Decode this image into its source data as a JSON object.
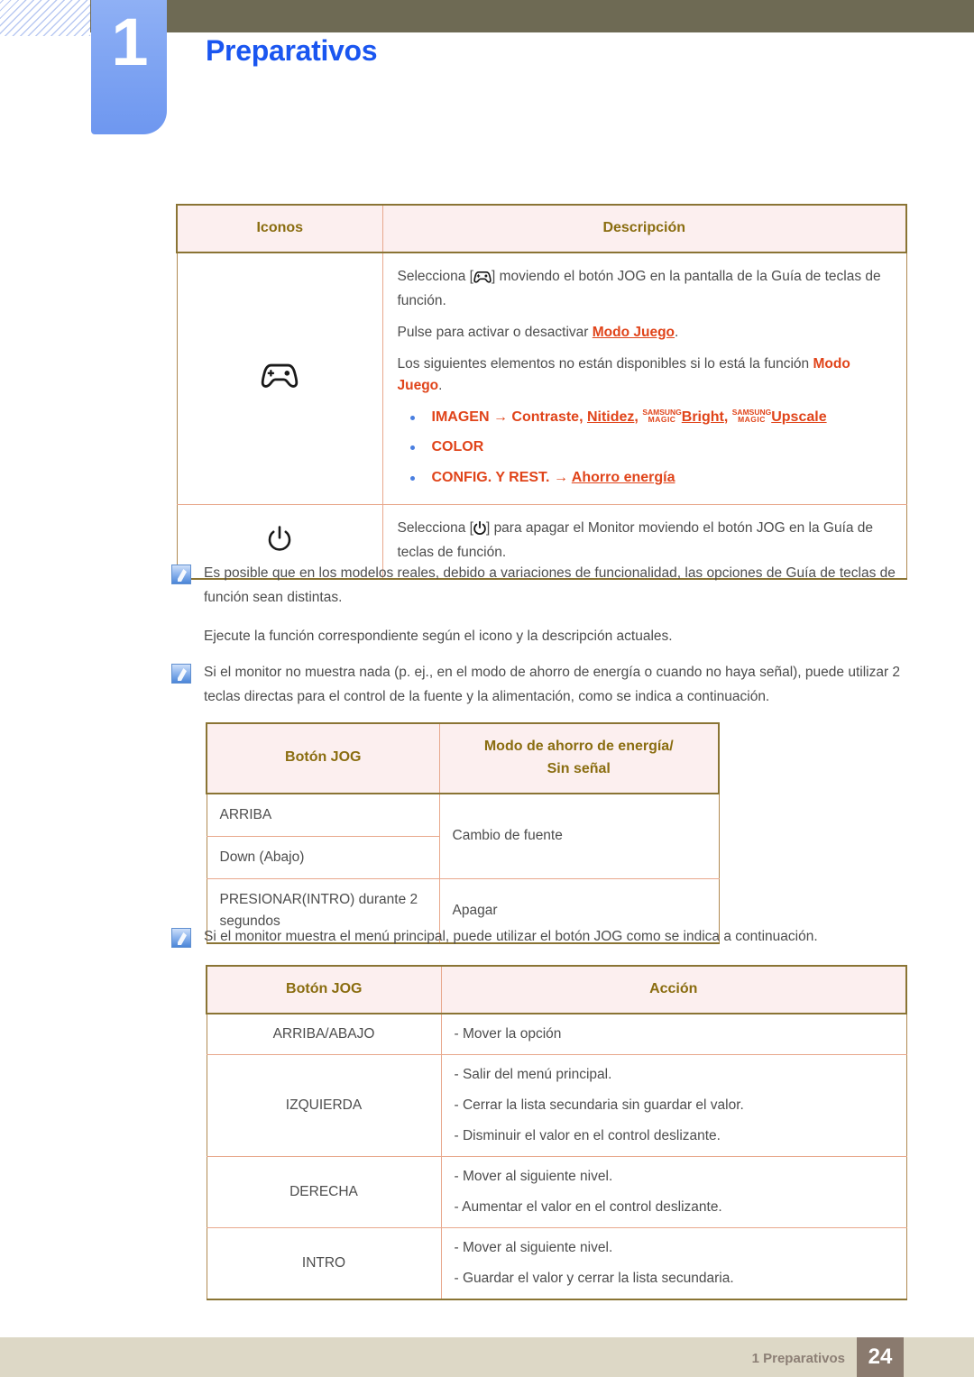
{
  "header": {
    "chapter_number": "1",
    "chapter_title": "Preparativos"
  },
  "table_icons": {
    "headers": [
      "Iconos",
      "Descripción"
    ],
    "rows": [
      {
        "icon": "gamepad-icon",
        "lines": [
          {
            "pre": "Selecciona [",
            "icon": "gamepad-icon",
            "post": "] moviendo el botón JOG en la pantalla de la Guía de teclas de función."
          },
          {
            "pre": "Pulse para activar o desactivar ",
            "link": "Modo Juego",
            "post": "."
          },
          {
            "pre": "Los siguientes elementos no están disponibles si lo está la función ",
            "bold": "Modo Juego",
            "post": "."
          }
        ],
        "bullets": [
          {
            "segments": [
              {
                "text": "IMAGEN",
                "style": "plain"
              },
              {
                "text": " → ",
                "style": "plain"
              },
              {
                "text": "Contraste",
                "style": "plain"
              },
              {
                "text": ", ",
                "style": "plain"
              },
              {
                "text": "Nitidez",
                "style": "underline"
              },
              {
                "text": ", ",
                "style": "plain"
              },
              {
                "text": "SAMSUNG MAGIC",
                "style": "magic"
              },
              {
                "text": "Bright",
                "style": "underline"
              },
              {
                "text": ", ",
                "style": "plain"
              },
              {
                "text": "SAMSUNG MAGIC",
                "style": "magic"
              },
              {
                "text": "Upscale",
                "style": "underline"
              }
            ]
          },
          {
            "segments": [
              {
                "text": "COLOR",
                "style": "plain"
              }
            ]
          },
          {
            "segments": [
              {
                "text": "CONFIG. Y REST.",
                "style": "plain"
              },
              {
                "text": " → ",
                "style": "plain"
              },
              {
                "text": "Ahorro energía",
                "style": "underline"
              }
            ]
          }
        ]
      },
      {
        "icon": "power-icon",
        "lines": [
          {
            "pre": "Selecciona [",
            "icon": "power-icon",
            "post": "] para apagar el Monitor moviendo el botón JOG en la Guía de teclas de función."
          }
        ]
      }
    ],
    "magic_top": "SAMSUNG",
    "magic_bottom": "MAGIC"
  },
  "note_one": {
    "icon": "note-icon",
    "paragraphs": [
      "Es posible que en los modelos reales, debido a variaciones de funcionalidad, las opciones de Guía de teclas de función sean distintas.",
      "Ejecute la función correspondiente según el icono y la descripción actuales."
    ]
  },
  "note_two": {
    "icon": "note-icon",
    "paragraphs": [
      "Si el monitor no muestra nada (p. ej., en el modo de ahorro de energía o cuando no haya señal), puede utilizar 2 teclas directas para el control de la fuente y la alimentación, como se indica a continuación."
    ]
  },
  "note_three": {
    "icon": "note-icon",
    "paragraphs": [
      "Si el monitor muestra el menú principal, puede utilizar el botón JOG como se indica a continuación."
    ]
  },
  "table_jog_power": {
    "headers": [
      "Botón JOG",
      "Modo de ahorro de energía/\nSin señal"
    ],
    "header_line1": "Modo de ahorro de energía/",
    "header_line2": "Sin señal",
    "rows": [
      {
        "button": "ARRIBA",
        "action": "Cambio de fuente"
      },
      {
        "button": "Down (Abajo)",
        "action": ""
      },
      {
        "button": "PRESIONAR(INTRO) durante 2 segundos",
        "action": "Apagar"
      }
    ]
  },
  "table_jog_action": {
    "headers": [
      "Botón JOG",
      "Acción"
    ],
    "rows": [
      {
        "button": "ARRIBA/ABAJO",
        "actions": [
          "- Mover la opción"
        ]
      },
      {
        "button": "IZQUIERDA",
        "actions": [
          "- Salir del menú principal.",
          "- Cerrar la lista secundaria sin guardar el valor.",
          "- Disminuir el valor en el control deslizante."
        ]
      },
      {
        "button": "DERECHA",
        "actions": [
          "- Mover al siguiente nivel.",
          "- Aumentar el valor en el control deslizante."
        ]
      },
      {
        "button": "INTRO",
        "actions": [
          "- Mover al siguiente nivel.",
          "- Guardar el valor y cerrar la lista secundaria."
        ]
      }
    ]
  },
  "footer": {
    "chapter_label": "1 Preparativos",
    "page_number": "24"
  },
  "colors": {
    "accent_blue": "#1a56f0",
    "tab_blue": "#7ca2f2",
    "top_bar": "#6e6a54",
    "table_header_bg": "#fcefef",
    "table_header_text": "#8a6d10",
    "table_border": "#e8a88c",
    "table_outer_border": "#8a7434",
    "link_orange": "#e0441a",
    "body_text": "#4d4d4d",
    "footer_band": "#ddd8c6",
    "footer_page_box": "#8a7a6e"
  }
}
